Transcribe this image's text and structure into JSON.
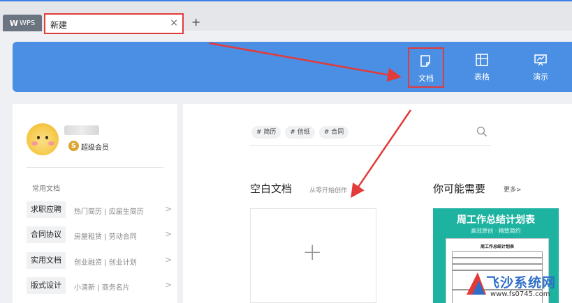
{
  "tabs": {
    "wps_label": "WPS",
    "active_label": "新建",
    "close_symbol": "×",
    "new_tab_symbol": "+"
  },
  "header": {
    "buttons": [
      {
        "label": "文档",
        "icon": "document-icon",
        "selected": true
      },
      {
        "label": "表格",
        "icon": "spreadsheet-icon",
        "selected": false
      },
      {
        "label": "演示",
        "icon": "presentation-icon",
        "selected": false
      }
    ]
  },
  "sidebar": {
    "vip_badge": "S",
    "vip_label": "超级会员",
    "section_title": "常用文档",
    "categories": [
      {
        "label": "求职应聘",
        "subs": "热门简历 | 应届生简历"
      },
      {
        "label": "合同协议",
        "subs": "房屋租赁 | 劳动合同"
      },
      {
        "label": "实用文档",
        "subs": "创业融资 | 创业计划"
      },
      {
        "label": "版式设计",
        "subs": "小清新 | 商务名片"
      }
    ],
    "arrow": ">"
  },
  "main": {
    "tags": [
      "# 简历",
      "# 信纸",
      "# 合同"
    ],
    "blank_title": "空白文档",
    "blank_subtitle": "从零开始创作",
    "blank_plus": "+",
    "need_title": "你可能需要",
    "more_label": "更多>",
    "template": {
      "title": "周工作总结计划表",
      "subtitle": "高效原创 · 精致简约",
      "paper_title": "周工作总结计划表"
    }
  },
  "watermark": {
    "name": "飞沙系统网",
    "url": "www.fs0745.com"
  },
  "colors": {
    "header_blue": "#4a8fe3",
    "highlight_red": "#e33a3a",
    "template_teal": "#1db3a0",
    "vip_gold": "#d9a531"
  }
}
